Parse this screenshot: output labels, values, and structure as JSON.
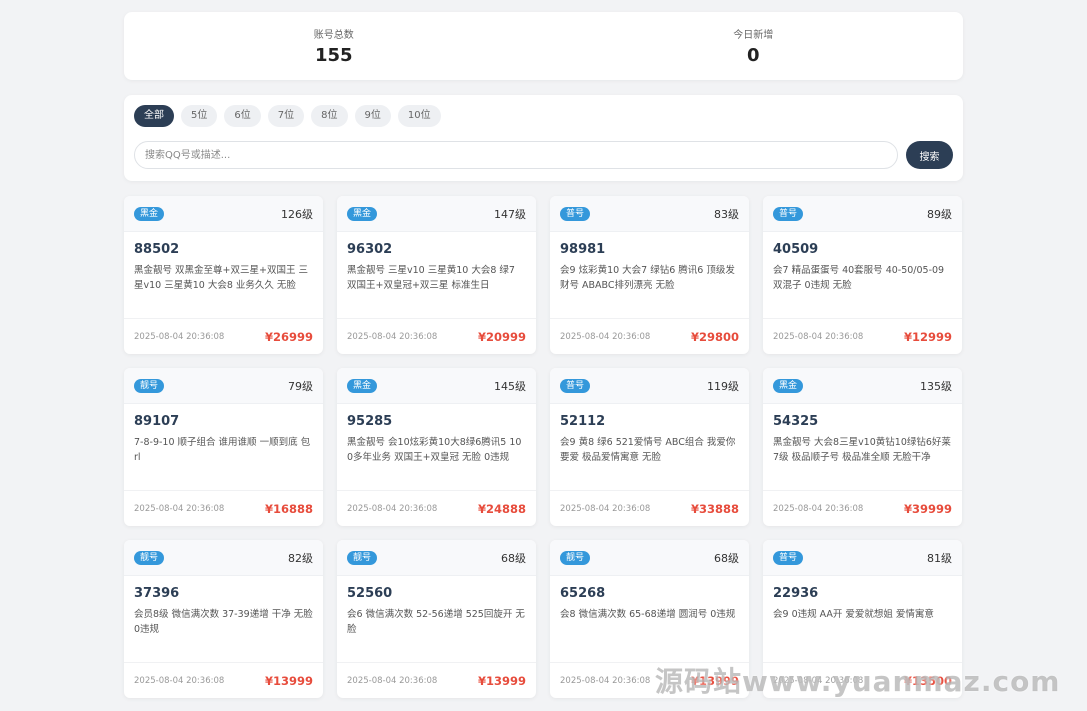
{
  "stats": {
    "total_label": "账号总数",
    "total_value": "155",
    "today_label": "今日新增",
    "today_value": "0"
  },
  "filter": {
    "tabs": [
      "全部",
      "5位",
      "6位",
      "7位",
      "8位",
      "9位",
      "10位"
    ],
    "active_tab": "全部",
    "search_placeholder": "搜索QQ号或描述...",
    "search_button": "搜索"
  },
  "cards": [
    {
      "badge": "黑金",
      "level": "126级",
      "qq": "88502",
      "desc": "黑金靓号 双黑金至尊+双三星+双国王 三星v10 三星黄10 大会8 业务久久 无脸",
      "time": "2025-08-04 20:36:08",
      "price": "¥26999"
    },
    {
      "badge": "黑金",
      "level": "147级",
      "qq": "96302",
      "desc": "黑金靓号 三星v10 三星黄10 大会8 绿7 双国王+双皇冠+双三星 标准生日",
      "time": "2025-08-04 20:36:08",
      "price": "¥20999"
    },
    {
      "badge": "普号",
      "level": "83级",
      "qq": "98981",
      "desc": "会9 炫彩黄10 大会7 绿钻6 腾讯6 顶级发财号 ABABC排列漂亮 无脸",
      "time": "2025-08-04 20:36:08",
      "price": "¥29800"
    },
    {
      "badge": "普号",
      "level": "89级",
      "qq": "40509",
      "desc": "会7 精品蛋蛋号 40套服号 40-50/05-09 双混子 0违规 无脸",
      "time": "2025-08-04 20:36:08",
      "price": "¥12999"
    },
    {
      "badge": "靓号",
      "level": "79级",
      "qq": "89107",
      "desc": "7-8-9-10 顺子组合 谁用谁顺 一顺到底 包rl",
      "time": "2025-08-04 20:36:08",
      "price": "¥16888"
    },
    {
      "badge": "黑金",
      "level": "145级",
      "qq": "95285",
      "desc": "黑金靓号 会10炫彩黄10大8绿6腾讯5 100多年业务 双国王+双皇冠 无脸 0违规",
      "time": "2025-08-04 20:36:08",
      "price": "¥24888"
    },
    {
      "badge": "普号",
      "level": "119级",
      "qq": "52112",
      "desc": "会9 黄8 绿6 521爱情号 ABC组合 我爱你 要爱 极品爱情寓意 无脸",
      "time": "2025-08-04 20:36:08",
      "price": "¥33888"
    },
    {
      "badge": "黑金",
      "level": "135级",
      "qq": "54325",
      "desc": "黑金靓号 大会8三星v10黄钻10绿钻6好莱7级 极品顺子号 极品准全顺 无脸干净",
      "time": "2025-08-04 20:36:08",
      "price": "¥39999"
    },
    {
      "badge": "靓号",
      "level": "82级",
      "qq": "37396",
      "desc": "会员8级 微信满次数 37-39递增 干净 无脸 0违规",
      "time": "2025-08-04 20:36:08",
      "price": "¥13999"
    },
    {
      "badge": "靓号",
      "level": "68级",
      "qq": "52560",
      "desc": "会6 微信满次数 52-56递增 525回旋开 无脸",
      "time": "2025-08-04 20:36:08",
      "price": "¥13999"
    },
    {
      "badge": "靓号",
      "level": "68级",
      "qq": "65268",
      "desc": "会8 微信满次数 65-68递增 圆润号 0违规",
      "time": "2025-08-04 20:36:08",
      "price": "¥13999"
    },
    {
      "badge": "普号",
      "level": "81级",
      "qq": "22936",
      "desc": "会9 0违规 AA开 爱爱就想姐 爱情寓意",
      "time": "2025-08-04 20:36:08",
      "price": "¥13500"
    }
  ],
  "watermark": "源码站www.yuanmaz.com"
}
